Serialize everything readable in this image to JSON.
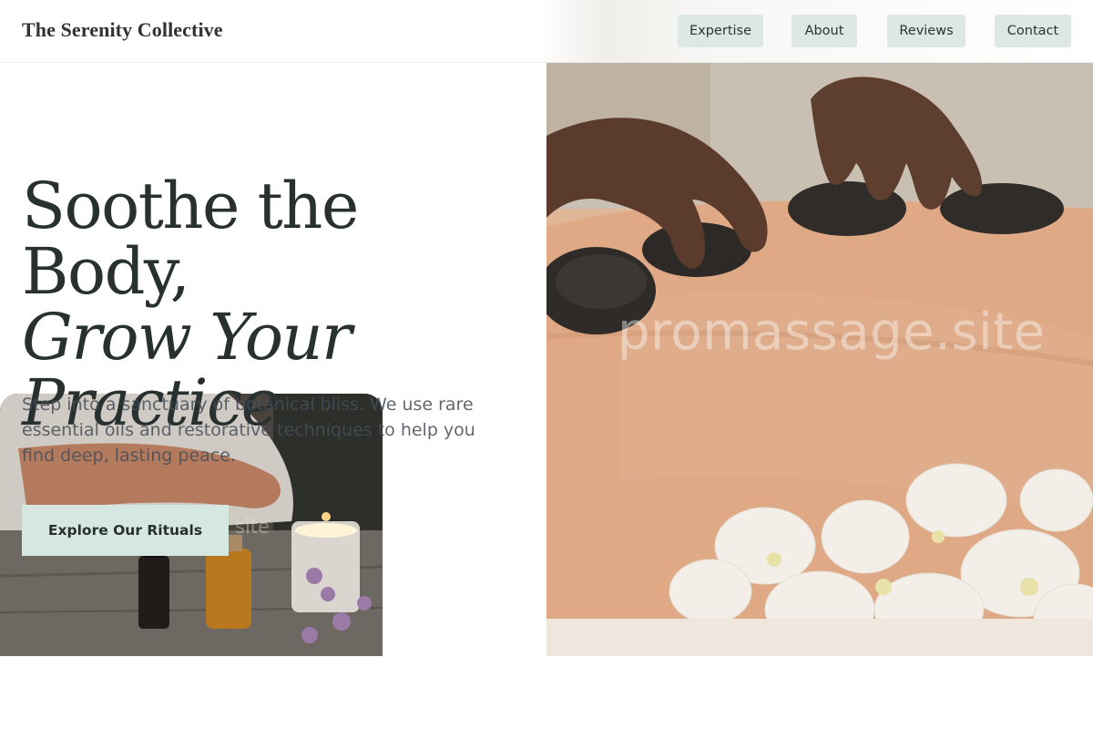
{
  "header": {
    "brand": "The Serenity Collective",
    "nav": [
      {
        "label": "Expertise"
      },
      {
        "label": "About"
      },
      {
        "label": "Reviews"
      },
      {
        "label": "Contact"
      }
    ]
  },
  "hero": {
    "headline_line1": "Soothe the Body,",
    "headline_line2": "Grow Your",
    "headline_line3": "Practice.",
    "subtext": "Step into a sanctuary of botanical bliss. We use rare essential oils and restorative techniques to help you find deep, lasting peace.",
    "cta_label": "Explore Our Rituals"
  },
  "images": {
    "main_watermark": "promassage.site",
    "thumb_watermark": "site"
  },
  "colors": {
    "accent": "#d6e7e2",
    "nav_button": "#dde8e5",
    "text": "#283030"
  }
}
